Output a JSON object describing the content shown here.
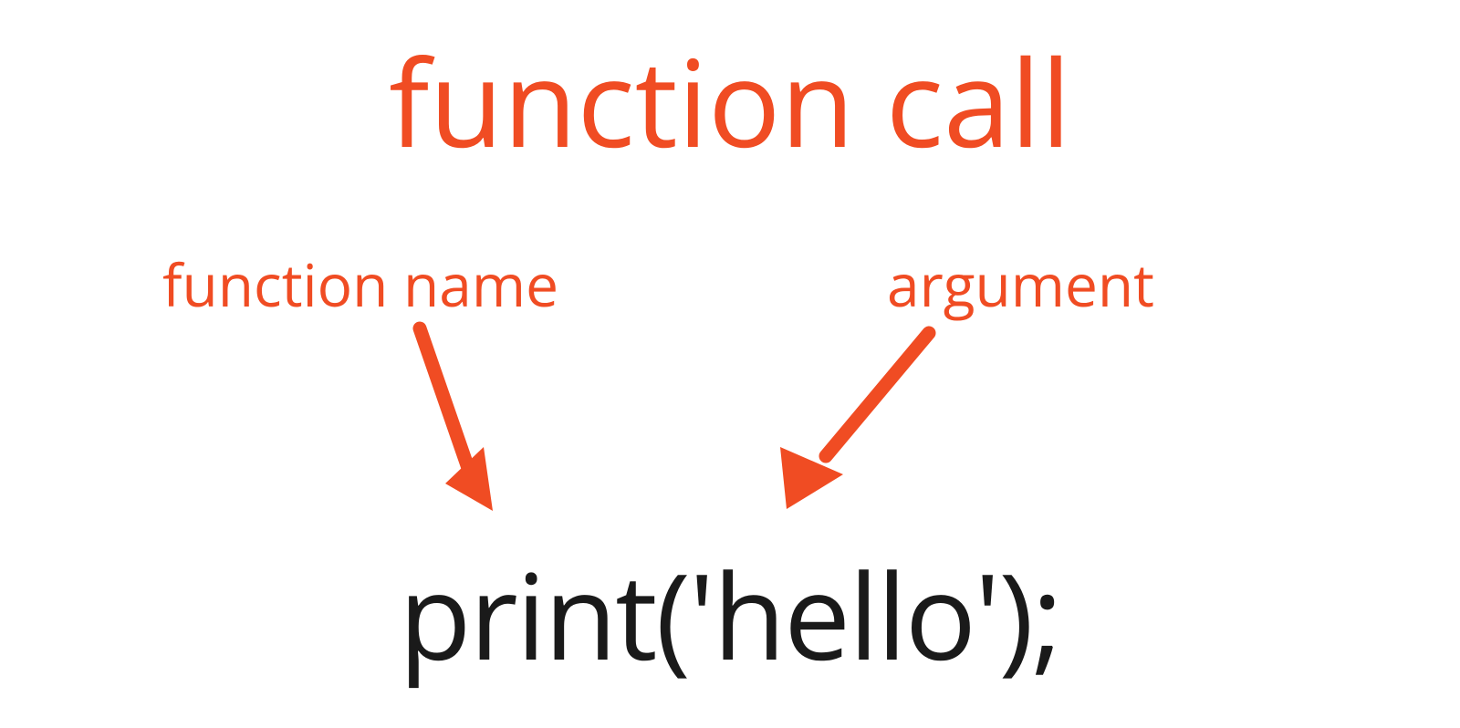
{
  "diagram": {
    "title": "function call",
    "labels": {
      "function_name": "function name",
      "argument": "argument"
    },
    "code": "print('hello');",
    "colors": {
      "accent": "#f04c23",
      "text": "#1a1a1a"
    }
  }
}
